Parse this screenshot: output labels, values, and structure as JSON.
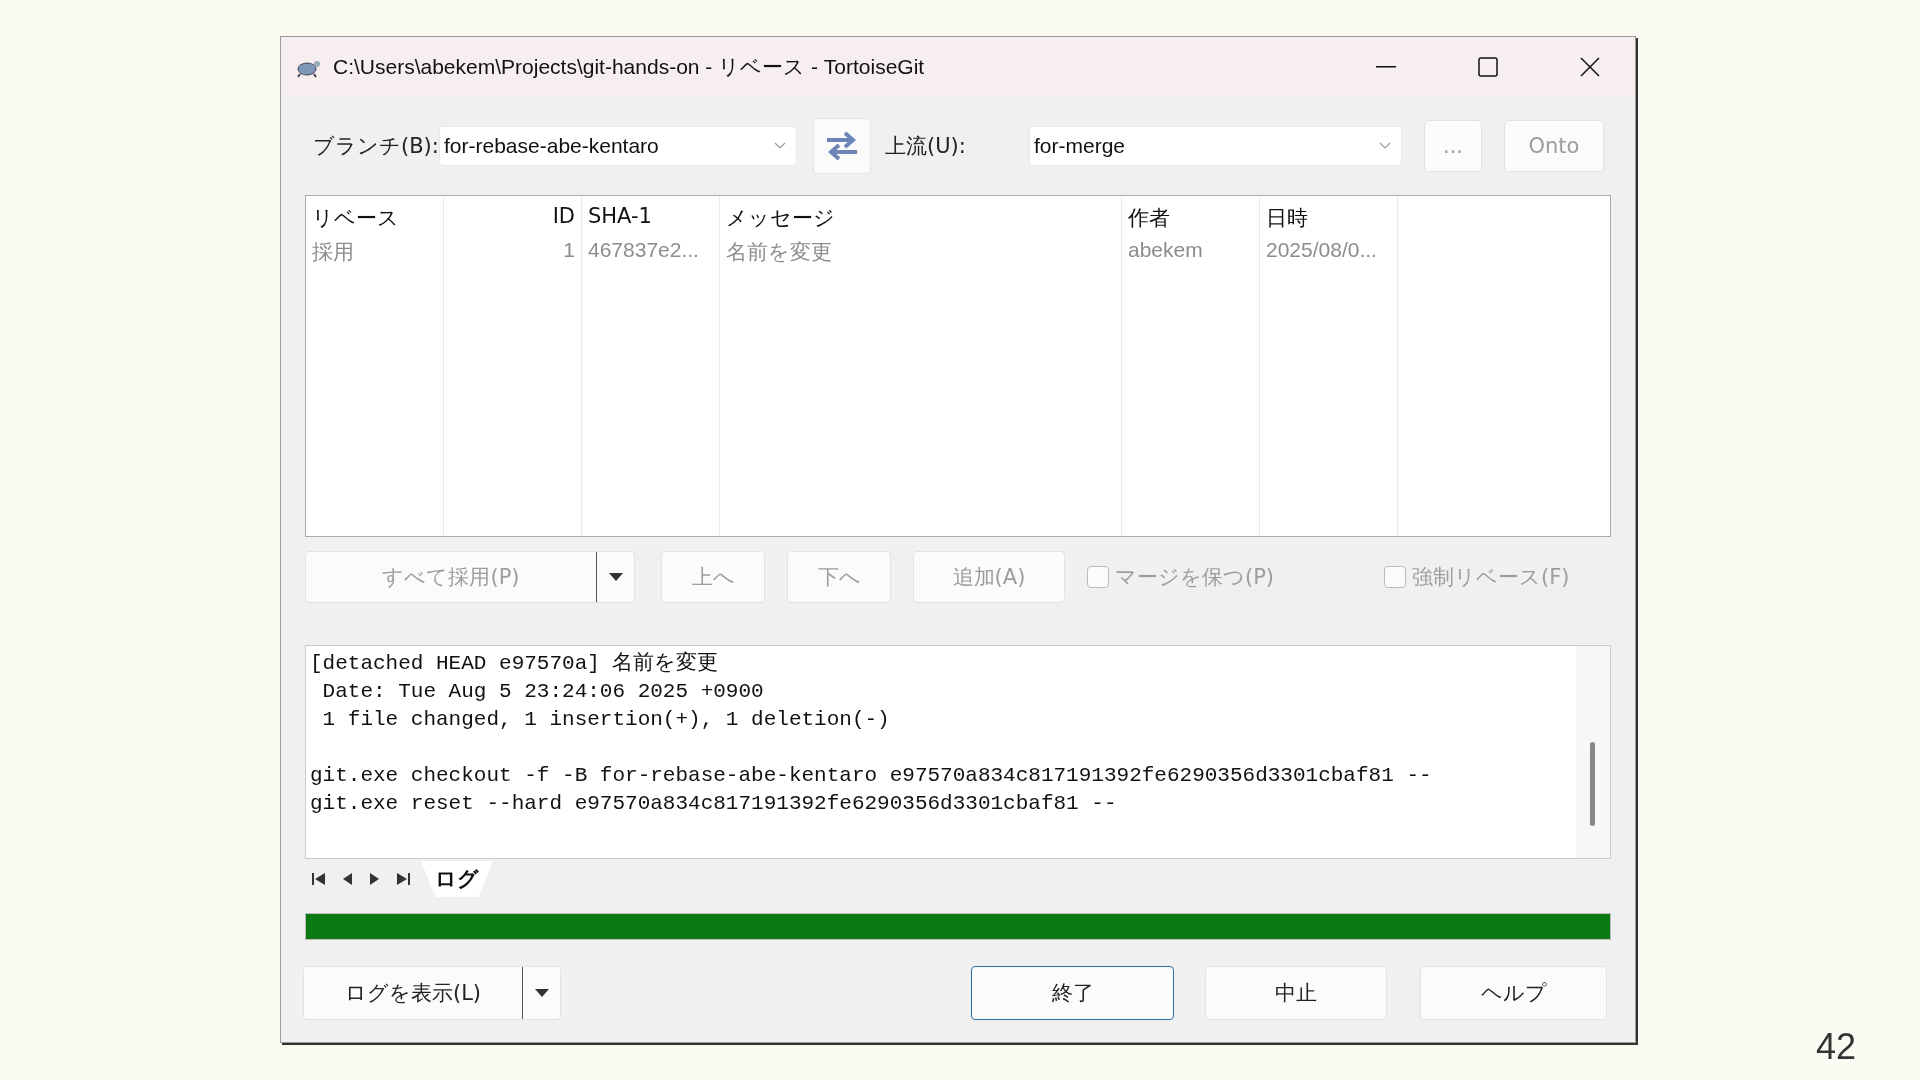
{
  "window": {
    "title": "C:\\Users\\abekem\\Projects\\git-hands-on - リベース - TortoiseGit"
  },
  "branch": {
    "label": "ブランチ(B):",
    "value": "for-rebase-abe-kentaro"
  },
  "upstream": {
    "label": "上流(U):",
    "value": "for-merge"
  },
  "top_buttons": [
    {
      "label": "...",
      "disabled": true
    },
    {
      "label": "Onto",
      "disabled": true
    }
  ],
  "table": {
    "columns": [
      {
        "label": "リベース",
        "kind": "text"
      },
      {
        "label": "ID",
        "kind": "number"
      },
      {
        "label": "SHA-1",
        "kind": "text"
      },
      {
        "label": "メッセージ",
        "kind": "text"
      },
      {
        "label": "作者",
        "kind": "text"
      },
      {
        "label": "日時",
        "kind": "text"
      }
    ],
    "rows": [
      {
        "cells": [
          "採用",
          "1",
          "467837e2...",
          "名前を変更",
          "abekem",
          "2025/08/0..."
        ],
        "disabled": true
      }
    ]
  },
  "actions": [
    {
      "label": "すべて採用(P)",
      "kind": "split",
      "disabled": true
    },
    {
      "label": "上へ",
      "kind": "button",
      "disabled": true
    },
    {
      "label": "下へ",
      "kind": "button",
      "disabled": true
    },
    {
      "label": "追加(A)",
      "kind": "button",
      "disabled": true
    }
  ],
  "options": [
    {
      "label": "マージを保つ(P)",
      "checked": false,
      "disabled": true
    },
    {
      "label": "強制リベース(F)",
      "checked": false,
      "disabled": true
    }
  ],
  "log": {
    "paragraphs": [
      {
        "lines": [
          "[detached HEAD e97570a] 名前を変更",
          " Date: Tue Aug 5 23:24:06 2025 +0900",
          " 1 file changed, 1 insertion(+), 1 deletion(-)"
        ]
      },
      {
        "lines": [
          "git.exe checkout -f -B for-rebase-abe-kentaro e97570a834c817191392fe6290356d3301cbaf81 --",
          "git.exe reset --hard e97570a834c817191392fe6290356d3301cbaf81 --"
        ]
      }
    ]
  },
  "tabs": [
    {
      "label": "ログ",
      "selected": true
    }
  ],
  "progress": {
    "level": 1
  },
  "bottom_buttons": [
    {
      "label": "ログを表示(L)",
      "kind": "split",
      "default": false
    },
    {
      "label": "終了",
      "kind": "button",
      "default": true
    },
    {
      "label": "中止",
      "kind": "button",
      "default": false
    },
    {
      "label": "ヘルプ",
      "kind": "button",
      "default": false
    }
  ],
  "slide_number": "42"
}
